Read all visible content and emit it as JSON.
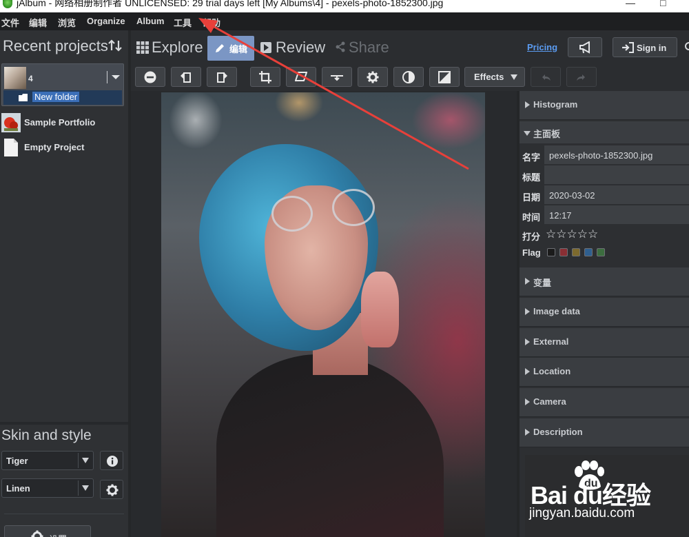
{
  "window": {
    "title": "jAlbum - 网络相册制作者 UNLICENSED: 29 trial days left [My Albums\\4] - pexels-photo-1852300.jpg",
    "minimize": "—",
    "maximize": "□"
  },
  "menu": [
    "文件",
    "编辑",
    "浏览",
    "Organize",
    "Album",
    "工具",
    "帮助"
  ],
  "left": {
    "recent_title": "Recent projects",
    "project": {
      "name": "4",
      "folder": "New folder"
    },
    "projects": [
      {
        "label": "Sample Portfolio",
        "icon": "flower-thumbnail"
      },
      {
        "label": "Empty Project",
        "icon": "document-icon"
      }
    ],
    "skin_title": "Skin and style",
    "skin_value": "Tiger",
    "style_value": "Linen",
    "settings_label": "设置"
  },
  "tabs": {
    "explore": "Explore",
    "edit": "编辑",
    "review": "Review",
    "share": "Share",
    "pricing": "Pricing",
    "signin": "Sign in"
  },
  "toolbar": {
    "effects": "Effects",
    "tools": [
      "minus-circle-icon",
      "rotate-left-icon",
      "rotate-right-icon",
      "crop-icon",
      "perspective-icon",
      "straighten-icon",
      "settings-icon",
      "contrast-icon",
      "exposure-icon"
    ]
  },
  "right": {
    "sections_top": [
      "Histogram"
    ],
    "main_panel": "主面板",
    "fields": {
      "name_label": "名字",
      "name_value": "pexels-photo-1852300.jpg",
      "title_label": "标题",
      "title_value": "",
      "date_label": "日期",
      "date_value": "2020-03-02",
      "time_label": "时间",
      "time_value": "12:17",
      "rating_label": "打分",
      "rating_stars": "☆☆☆☆☆",
      "flag_label": "Flag"
    },
    "flag_colors": [
      "#1b1b1b",
      "#8a2f34",
      "#7d6a2e",
      "#2f5f8f",
      "#3c6d3f"
    ],
    "sections_bottom": [
      "变量",
      "Image data",
      "External",
      "Location",
      "Camera",
      "Description"
    ]
  },
  "watermark": {
    "brand": "Bai  du",
    "brand_cn": "经验",
    "url": "jingyan.baidu.com"
  },
  "colors": {
    "accent": "#7b96c4",
    "link": "#5b9cf2",
    "arrow": "#e8403a"
  }
}
